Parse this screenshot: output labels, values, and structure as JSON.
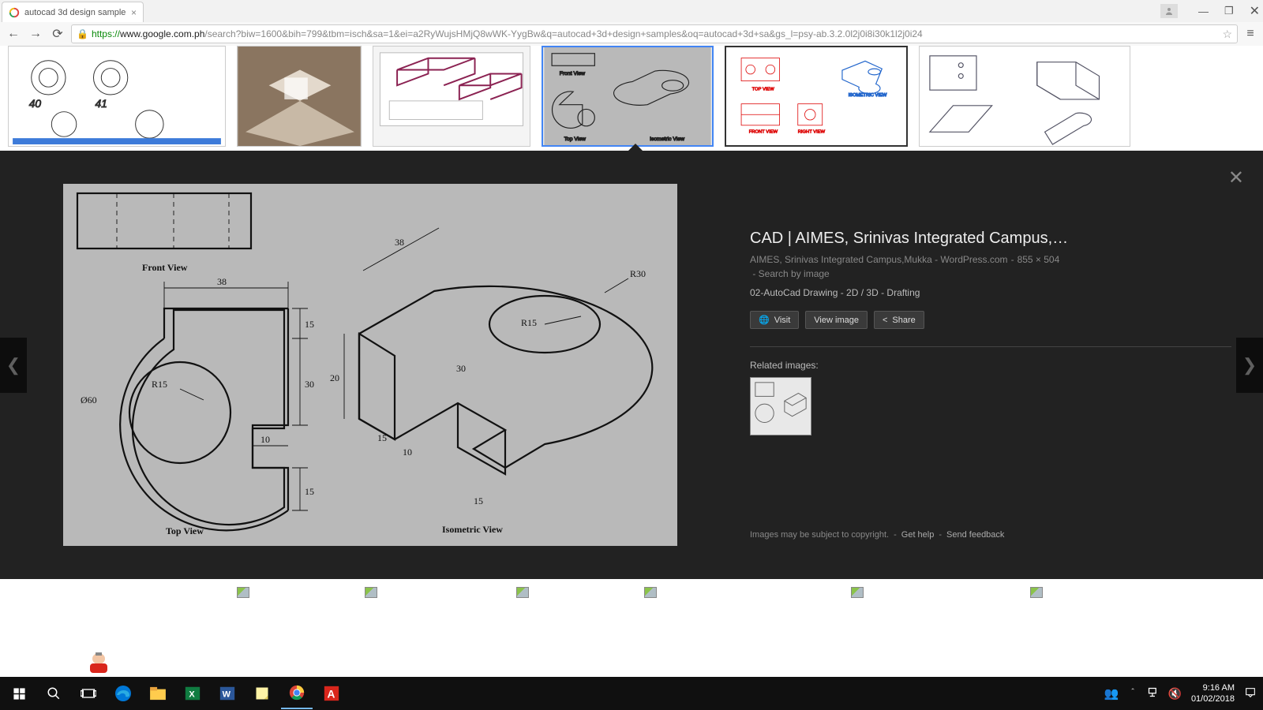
{
  "browser": {
    "tab_title": "autocad 3d design sample",
    "url_proto": "https://",
    "url_host": "www.google.com.ph",
    "url_path": "/search?biw=1600&bih=799&tbm=isch&sa=1&ei=a2RyWujsHMjQ8wWK-YygBw&q=autocad+3d+design+samples&oq=autocad+3d+sa&gs_l=psy-ab.3.2.0l2j0i8i30k1l2j0i24"
  },
  "viewer": {
    "title": "CAD | AIMES, Srinivas Integrated Campus,…",
    "source": "AIMES, Srinivas Integrated Campus,Mukka - WordPress.com",
    "dimensions": "855 × 504",
    "search_by_image": "Search by image",
    "description": "02-AutoCad Drawing - 2D / 3D - Drafting",
    "btn_visit": "Visit",
    "btn_view": "View image",
    "btn_share": "Share",
    "related_label": "Related images:",
    "copyright": "Images may be subject to copyright.",
    "get_help": "Get help",
    "send_feedback": "Send feedback"
  },
  "cad": {
    "front_view": "Front View",
    "top_view": "Top View",
    "iso_view": "Isometric View",
    "dim_38": "38",
    "dim_15a": "15",
    "dim_15b": "15",
    "dim_10": "10",
    "dim_30": "30",
    "dim_20": "20",
    "r15": "R15",
    "r30": "R30",
    "d60": "Ø60",
    "iso_38": "38",
    "iso_30": "30",
    "iso_15a": "15",
    "iso_15b": "15",
    "iso_10": "10",
    "iso_r15": "R15",
    "iso_r30": "R30"
  },
  "taskbar": {
    "time": "9:16 AM",
    "date": "01/02/2018"
  }
}
